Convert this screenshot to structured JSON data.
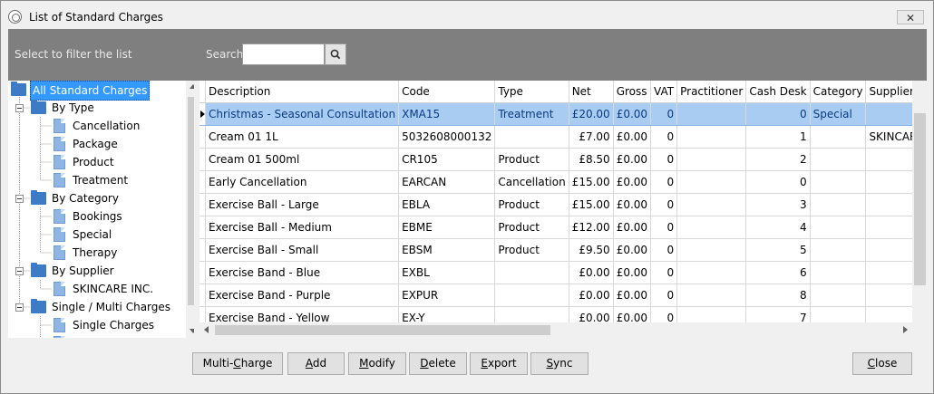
{
  "window": {
    "title": "List of Standard Charges",
    "close_glyph": "✕"
  },
  "filter": {
    "hint": "Select to filter the list",
    "search_label": "Search",
    "search_value": "",
    "search_icon": "search-icon"
  },
  "tree": {
    "root": "All Standard Charges",
    "nodes": [
      {
        "label": "By Type",
        "kind": "folder"
      },
      {
        "label": "Cancellation",
        "kind": "doc"
      },
      {
        "label": "Package",
        "kind": "doc"
      },
      {
        "label": "Product",
        "kind": "doc"
      },
      {
        "label": "Treatment",
        "kind": "doc"
      },
      {
        "label": "By Category",
        "kind": "folder"
      },
      {
        "label": "Bookings",
        "kind": "doc"
      },
      {
        "label": "Special",
        "kind": "doc"
      },
      {
        "label": "Therapy",
        "kind": "doc"
      },
      {
        "label": "By Supplier",
        "kind": "folder"
      },
      {
        "label": "SKINCARE INC.",
        "kind": "doc"
      },
      {
        "label": "Single / Multi Charges",
        "kind": "folder"
      },
      {
        "label": "Single Charges",
        "kind": "doc"
      }
    ]
  },
  "grid": {
    "columns": [
      "Description",
      "Code",
      "Type",
      "Net",
      "Gross",
      "VAT",
      "Practitioner",
      "Cash Desk",
      "Category",
      "Supplier"
    ],
    "rows": [
      {
        "description": "Christmas - Seasonal Consultation",
        "code": "XMA15",
        "type": "Treatment",
        "net": "£20.00",
        "gross": "£0.00",
        "vat": "0",
        "practitioner": "",
        "cash_desk": "0",
        "category": "Special",
        "supplier": "",
        "selected": true
      },
      {
        "description": "Cream 01 1L",
        "code": "5032608000132",
        "type": "",
        "net": "£7.00",
        "gross": "£0.00",
        "vat": "0",
        "practitioner": "",
        "cash_desk": "1",
        "category": "",
        "supplier": "SKINCARE I"
      },
      {
        "description": "Cream 01 500ml",
        "code": "CR105",
        "type": "Product",
        "net": "£8.50",
        "gross": "£0.00",
        "vat": "0",
        "practitioner": "",
        "cash_desk": "2",
        "category": "",
        "supplier": ""
      },
      {
        "description": "Early Cancellation",
        "code": "EARCAN",
        "type": "Cancellation",
        "net": "£15.00",
        "gross": "£0.00",
        "vat": "0",
        "practitioner": "",
        "cash_desk": "0",
        "category": "",
        "supplier": ""
      },
      {
        "description": "Exercise Ball - Large",
        "code": "EBLA",
        "type": "Product",
        "net": "£15.00",
        "gross": "£0.00",
        "vat": "0",
        "practitioner": "",
        "cash_desk": "3",
        "category": "",
        "supplier": ""
      },
      {
        "description": "Exercise Ball - Medium",
        "code": "EBME",
        "type": "Product",
        "net": "£12.00",
        "gross": "£0.00",
        "vat": "0",
        "practitioner": "",
        "cash_desk": "4",
        "category": "",
        "supplier": ""
      },
      {
        "description": "Exercise Ball - Small",
        "code": "EBSM",
        "type": "Product",
        "net": "£9.50",
        "gross": "£0.00",
        "vat": "0",
        "practitioner": "",
        "cash_desk": "5",
        "category": "",
        "supplier": ""
      },
      {
        "description": "Exercise Band - Blue",
        "code": "EXBL",
        "type": "",
        "net": "£0.00",
        "gross": "£0.00",
        "vat": "0",
        "practitioner": "",
        "cash_desk": "6",
        "category": "",
        "supplier": ""
      },
      {
        "description": "Exercise Band - Purple",
        "code": "EXPUR",
        "type": "",
        "net": "£0.00",
        "gross": "£0.00",
        "vat": "0",
        "practitioner": "",
        "cash_desk": "8",
        "category": "",
        "supplier": ""
      },
      {
        "description": "Exercise Band - Yellow",
        "code": "EX-Y",
        "type": "",
        "net": "£0.00",
        "gross": "£0.00",
        "vat": "0",
        "practitioner": "",
        "cash_desk": "7",
        "category": "",
        "supplier": ""
      }
    ]
  },
  "buttons": {
    "multi_charge_pre": "Multi-",
    "multi_charge_u": "C",
    "multi_charge_post": "harge",
    "add_u": "A",
    "add_post": "dd",
    "modify_u": "M",
    "modify_post": "odify",
    "delete_u": "D",
    "delete_post": "elete",
    "export_u": "E",
    "export_post": "xport",
    "sync_u": "S",
    "sync_post": "ync",
    "close_u": "C",
    "close_post": "lose"
  },
  "colors": {
    "filter_bar": "#7f7f7f",
    "selection": "#a9cdf2",
    "tree_selection": "#3399ff",
    "folder": "#3e7bc6"
  }
}
